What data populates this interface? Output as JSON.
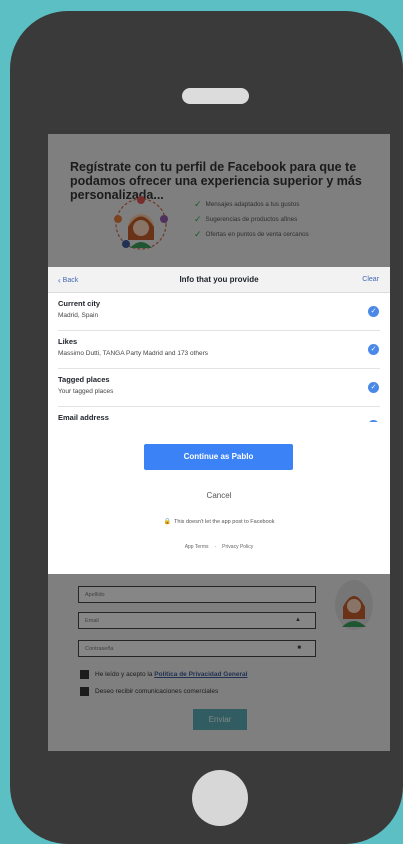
{
  "background_page": {
    "hero_title": "Regístrate con tu perfil de Facebook para que te podamos ofrecer una experiencia superior y más personalizada...",
    "bullets": [
      "Mensajes adaptados a tus gustos",
      "Sugerencias de productos afines",
      "Ofertas en puntos de venta cercanos"
    ],
    "fields": {
      "apellido": "Apellido",
      "email": "Email",
      "contrasena": "Contraseña"
    },
    "privacy_prefix": "He leído y acepto la",
    "privacy_link": "Política de Privacidad General",
    "newsletter": "Deseo recibir comunicaciones comerciales",
    "submit_label": "Enviar"
  },
  "modal": {
    "back_label": "Back",
    "title": "Info that you provide",
    "clear_label": "Clear",
    "items": [
      {
        "title": "Current city",
        "subtitle": "Madrid, Spain",
        "checked": true
      },
      {
        "title": "Likes",
        "subtitle": "Massimo Dutti, TANGA Party Madrid and 173 others",
        "checked": true
      },
      {
        "title": "Tagged places",
        "subtitle": "Your tagged places",
        "checked": true
      },
      {
        "title": "Email address",
        "subtitle": "",
        "checked": true
      }
    ],
    "continue_label": "Continue as Pablo",
    "cancel_label": "Cancel",
    "notice": "This doesn't let the app post to Facebook",
    "app_terms": "App Terms",
    "separator": "·",
    "privacy_policy": "Privacy Policy"
  },
  "colors": {
    "frame_bg": "#5bbfc4",
    "device": "#3a3a3a",
    "facebook_blue": "#4267b2",
    "continue_blue": "#3b82f6",
    "check_blue": "#4a89e8"
  }
}
